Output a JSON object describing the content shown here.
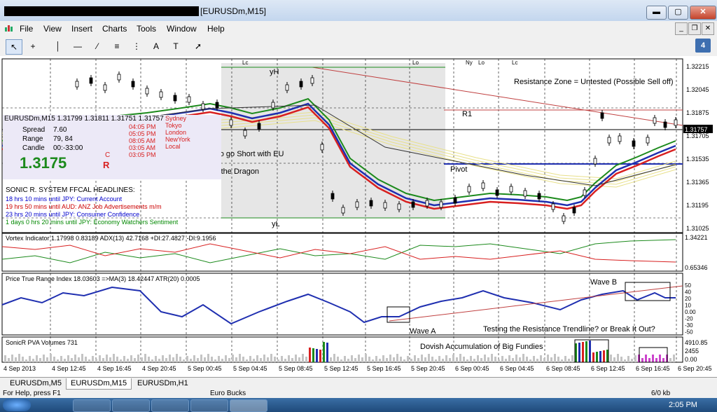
{
  "window": {
    "title": "[EURUSDm,M15]",
    "btn_min": "▬",
    "btn_max": "▢",
    "btn_close": "✕"
  },
  "menu": [
    "File",
    "View",
    "Insert",
    "Charts",
    "Tools",
    "Window",
    "Help"
  ],
  "toolbar": {
    "badge": "4",
    "tools": [
      "↖",
      "+",
      "│",
      "—",
      "⁄",
      "≡",
      "⋮",
      "A",
      "T",
      "➚"
    ]
  },
  "main_chart": {
    "header": "EURUSDm,M15  1.31799 1.31811 1.31751 1.31757",
    "spread_label": "Spread",
    "spread_value": "7.60",
    "range_label": "Range",
    "range_value": "79, 84",
    "candle_label": "Candle",
    "candle_value": "00:-33:00",
    "big_price": "1.3175",
    "c_label": "C",
    "r_label": "R",
    "sessions": [
      {
        "time": "04:05 PM",
        "city": "Sydney"
      },
      {
        "time": "05:05 PM",
        "city": "Tokyo"
      },
      {
        "time": "08:05 AM",
        "city": "London"
      },
      {
        "time": "03:05 AM",
        "city": "NewYork"
      },
      {
        "time": "03:05 PM",
        "city": "Local"
      }
    ],
    "annotations": {
      "yH": "yH",
      "yL": "yL",
      "r1": "R1",
      "pivot": "Pivot",
      "resistance": "Resistance Zone = Untested (Possible Sell off)",
      "analysis": "Analysis: I will wait for Wave C formation to go Short with EU",
      "entry": "Entry for Short: Price Action Crossing the Dragon"
    },
    "session_marks": [
      "Lc",
      "Lo",
      "Ny",
      "Lo",
      "Lc"
    ],
    "price_labels": [
      "1.32215",
      "1.32045",
      "1.31875",
      "1.31705",
      "1.31535",
      "1.31365",
      "1.31195",
      "1.31025"
    ],
    "current_price": "1.31757",
    "headlines_title": "SONIC R. SYSTEM  FFCAL HEADLINES:",
    "headlines": [
      {
        "text": "18 hrs 10 mins until JPY: Current Account",
        "color": "#0000cc"
      },
      {
        "text": "19 hrs 50 mins until AUD: ANZ Job Advertisements m/m",
        "color": "#cc0000"
      },
      {
        "text": "23 hrs 20 mins until JPY: Consumer Confidence",
        "color": "#0000cc"
      },
      {
        "text": "1 days 0 hrs 20 mins until JPY: Economy Watchers Sentiment",
        "color": "#008800"
      }
    ]
  },
  "vortex": {
    "header": "Vortex Indicator 1.17998 0.83189  ADX(13) 42.7168 +DI:27.4827 -DI:9.1956",
    "scale": [
      "1.34221",
      "0.65346"
    ]
  },
  "ptr": {
    "header": "Price True Range Index 18.03603  =>MA(3) 18.42447  ATR(20) 0.0005",
    "scale": [
      "50",
      "40",
      "20",
      "10",
      "0.00",
      "-20",
      "-30",
      "-50"
    ],
    "wave_a": "Wave A",
    "wave_b": "Wave B",
    "testing": "Testing the Resistance Trendline? or Break It Out?"
  },
  "volume": {
    "header": "SonicR PVA  Volumes 731",
    "scale": [
      "4910.85",
      "2455",
      "0.00"
    ],
    "annotation": "Dovish Accumulation of Big Fundies"
  },
  "time_axis": [
    "4 Sep 2013",
    "4 Sep 12:45",
    "4 Sep 16:45",
    "4 Sep 20:45",
    "5 Sep 00:45",
    "5 Sep 04:45",
    "5 Sep 08:45",
    "5 Sep 12:45",
    "5 Sep 16:45",
    "5 Sep 20:45",
    "6 Sep 00:45",
    "6 Sep 04:45",
    "6 Sep 08:45",
    "6 Sep 12:45",
    "6 Sep 16:45",
    "6 Sep 20:45"
  ],
  "tabs": [
    "EURUSDm,M5",
    "EURUSDm,M15",
    "EURUSDm,H1"
  ],
  "status": {
    "help": "For Help, press F1",
    "profile": "Euro Bucks",
    "traffic": "6/0 kb"
  },
  "taskbar": {
    "clock": "2:05 PM"
  },
  "colors": {
    "price_axis_bg": "#000000",
    "red_trend": "#c04040",
    "blue_line": "#1f2fb0",
    "green_line": "#1c8a1c",
    "red_line": "#d82020",
    "yellow_band": "#e8e08a",
    "session_shade": "#e6e6e6"
  }
}
